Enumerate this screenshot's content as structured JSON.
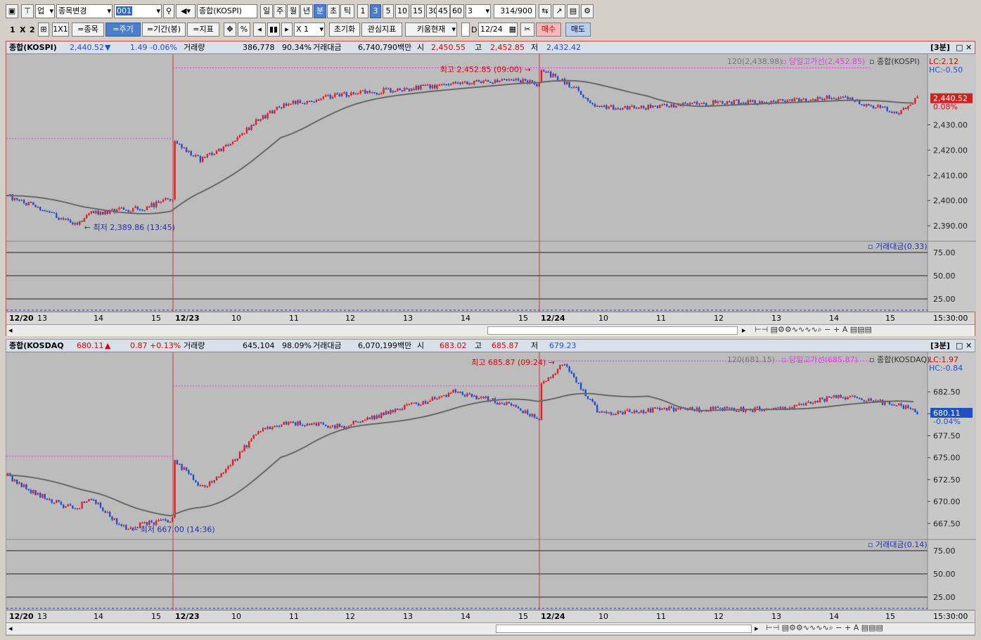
{
  "toolbar": {
    "market_select": "업",
    "stock_change": "종목변경",
    "code_value": "001",
    "index_name": "종합(KOSPI)",
    "periods": [
      "일",
      "주",
      "월",
      "년",
      "분",
      "초",
      "틱"
    ],
    "period_selected": "분",
    "minutes": [
      "1",
      "3",
      "5",
      "10",
      "15",
      "30",
      "45",
      "60"
    ],
    "minute_selected": "3",
    "minute_input": "3",
    "count_value": "314",
    "count_total": "/900"
  },
  "toolbar2": {
    "layout_labels": [
      "1",
      "X",
      "2"
    ],
    "grid_label": "1X1",
    "btn_stock": "=종목",
    "btn_period": "=주기",
    "btn_range": "=기간(봉)",
    "btn_indicator": "=지표",
    "zoom": "X 1",
    "btn_reset": "초기화",
    "btn_watch": "관심지표",
    "btn_kiwoom": "키움현재",
    "date_value": "12/24",
    "buy": "매수",
    "sell": "매도"
  },
  "panels": [
    {
      "name": "종합(KOSPI)",
      "price": "2,440.52",
      "arrow": "▼",
      "change": "1.49",
      "change_pct": "-0.06%",
      "vol_label": "거래량",
      "volume": "386,778",
      "vol_pct": "90.34%",
      "amt_label": "거래대금",
      "amount": "6,740,790백만",
      "open_label": "시",
      "open": "2,450.55",
      "high_label": "고",
      "high": "2,452.85",
      "low_label": "저",
      "low": "2,432.42",
      "period_tag": "[3분]",
      "ma_label": "120(2,438.98)",
      "day_high_label": "당일고가선(2,452.85)",
      "series_label": "종합(KOSPI)",
      "lc": "LC:2.12",
      "hc": "HC:-0.50",
      "max_note": "최고 2,452.85 (09:00)",
      "min_note": "최저 2,389.86 (13:45)",
      "last_box": "2,440.52",
      "last_pct": "0.08%",
      "yticks": [
        "2,430.00",
        "2,420.00",
        "2,410.00",
        "2,400.00",
        "2,390.00"
      ],
      "sub_label": "거래대금(0.33)",
      "sub_ticks": [
        "75.00",
        "50.00",
        "25.00"
      ],
      "x_labels": [
        "12/20",
        "13",
        "14",
        "15",
        "12/23",
        "10",
        "11",
        "12",
        "13",
        "14",
        "15",
        "12/24",
        "10",
        "11",
        "12",
        "13",
        "14",
        "15"
      ],
      "time_end": "15:30:00"
    },
    {
      "name": "종합(KOSDAQ",
      "price": "680.11",
      "arrow": "▲",
      "change": "0.87",
      "change_pct": "+0.13%",
      "vol_label": "거래량",
      "volume": "645,104",
      "vol_pct": "98.09%",
      "amt_label": "거래대금",
      "amount": "6,070,199백만",
      "open_label": "시",
      "open": "683.02",
      "high_label": "고",
      "high": "685.87",
      "low_label": "저",
      "low": "679.23",
      "period_tag": "[3분]",
      "ma_label": "120(681.15)",
      "day_high_label": "당일고가선(685.87)",
      "series_label": "종합(KOSDAQ)",
      "lc": "LC:1.97",
      "hc": "HC:-0.84",
      "max_note": "최고 685.87 (09:24)",
      "min_note": "최저 667.00 (14:36)",
      "last_box": "680.11",
      "last_pct": "-0.04%",
      "yticks": [
        "682.50",
        "680.00",
        "677.50",
        "675.00",
        "672.50",
        "670.00",
        "667.50"
      ],
      "sub_label": "거래대금(0.14)",
      "sub_ticks": [
        "75.00",
        "50.00",
        "25.00"
      ],
      "x_labels": [
        "12/20",
        "13",
        "14",
        "15",
        "12/23",
        "10",
        "11",
        "12",
        "13",
        "14",
        "15",
        "12/24",
        "10",
        "11",
        "12",
        "13",
        "14",
        "15"
      ],
      "time_end": "15:30:00"
    }
  ],
  "colors": {
    "up": "#e02020",
    "down": "#1f4fd0",
    "ma": "#6a6a6a",
    "dayhigh": "#e040e0",
    "plot_bg": "#bcbcbc"
  },
  "chart_data": [
    {
      "type": "line",
      "title": "종합(KOSPI) 3분",
      "x": [
        "12/20 12:30",
        "12/20 13:00",
        "12/20 13:45",
        "12/20 14:00",
        "12/20 15:00",
        "12/20 15:30",
        "12/23 09:00",
        "12/23 09:30",
        "12/23 10:00",
        "12/23 10:30",
        "12/23 11:00",
        "12/23 12:00",
        "12/23 13:00",
        "12/23 14:00",
        "12/23 15:00",
        "12/23 15:30",
        "12/24 09:00",
        "12/24 09:30",
        "12/24 10:00",
        "12/24 11:00",
        "12/24 12:00",
        "12/24 13:00",
        "12/24 14:00",
        "12/24 15:00",
        "12/24 15:20"
      ],
      "series": [
        {
          "name": "종합(KOSPI)",
          "values": [
            2402,
            2398,
            2390,
            2395,
            2397,
            2401,
            2424,
            2416,
            2422,
            2432,
            2438,
            2442,
            2444,
            2446,
            2448,
            2446,
            2452,
            2446,
            2437,
            2437,
            2439,
            2439,
            2441,
            2435,
            2440.52
          ]
        }
      ],
      "ylim": [
        2385,
        2458
      ]
    },
    {
      "type": "line",
      "title": "종합(KOSDAQ) 3분",
      "x": [
        "12/20 12:30",
        "12/20 13:00",
        "12/20 13:45",
        "12/20 14:00",
        "12/20 14:36",
        "12/20 15:30",
        "12/23 09:00",
        "12/23 09:30",
        "12/23 10:00",
        "12/23 10:30",
        "12/23 11:00",
        "12/23 12:00",
        "12/23 13:00",
        "12/23 14:00",
        "12/23 15:00",
        "12/23 15:30",
        "12/24 09:00",
        "12/24 09:24",
        "12/24 10:00",
        "12/24 11:00",
        "12/24 12:00",
        "12/24 13:00",
        "12/24 14:00",
        "12/24 15:00",
        "12/24 15:20"
      ],
      "series": [
        {
          "name": "종합(KOSDAQ)",
          "values": [
            673,
            671,
            669,
            670.5,
            667,
            668,
            675,
            671.5,
            674,
            678,
            679,
            678.5,
            680.5,
            682.5,
            681,
            679.5,
            683,
            685.87,
            680,
            680.5,
            680.5,
            680.5,
            682,
            681,
            680.11
          ]
        }
      ],
      "ylim": [
        666,
        687
      ]
    }
  ]
}
